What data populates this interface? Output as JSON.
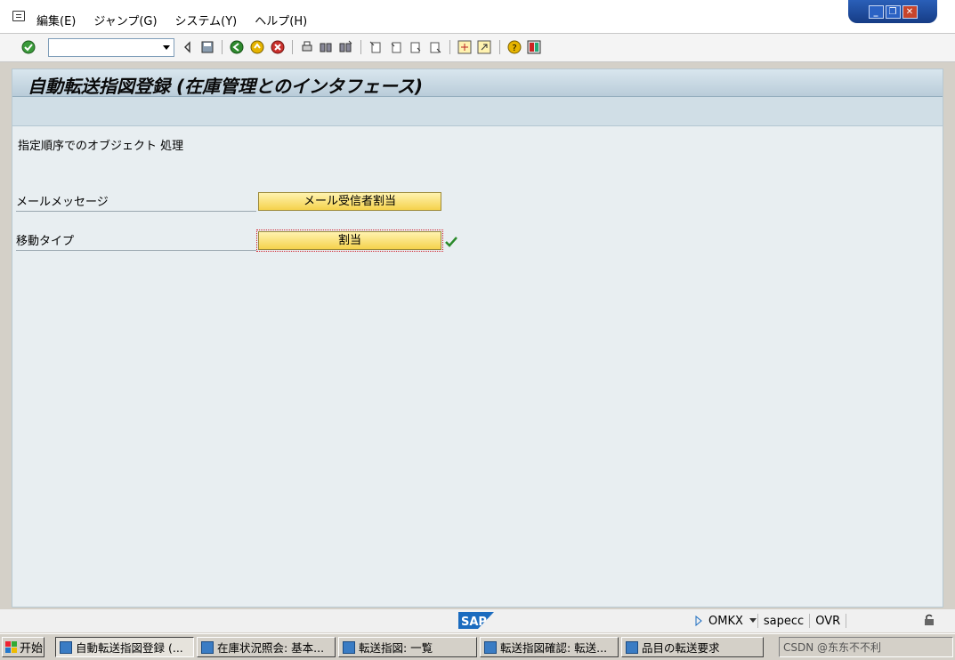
{
  "menubar": {
    "items": [
      "編集(E)",
      "ジャンプ(G)",
      "システム(Y)",
      "ヘルプ(H)"
    ],
    "window_controls": [
      "_",
      "❐",
      "✕"
    ]
  },
  "toolbar": {
    "command_placeholder": ""
  },
  "screen": {
    "title": "自動転送指図登録 (在庫管理とのインタフェース)",
    "section_text": "指定順序でのオブジェクト 処理",
    "rows": [
      {
        "label": "メールメッセージ",
        "button": "メール受信者割当"
      },
      {
        "label": "移動タイプ",
        "button": "割当"
      }
    ]
  },
  "statusbar": {
    "logo": "SAP",
    "transaction": "OMKX",
    "server": "sapecc",
    "mode": "OVR"
  },
  "taskbar": {
    "start_label": "开始",
    "tasks": [
      "自動転送指図登録 (...",
      "在庫状況照会: 基本...",
      "転送指図: 一覧",
      "転送指図確認: 転送...",
      "品目の転送要求"
    ],
    "tray_text": "CSDN @东东不不利"
  },
  "colors": {
    "button_yellow": "#f5d24c",
    "panel_bg": "#e8eef1",
    "title_bar": "#b9ccd9",
    "check_green": "#2a8a2a"
  }
}
